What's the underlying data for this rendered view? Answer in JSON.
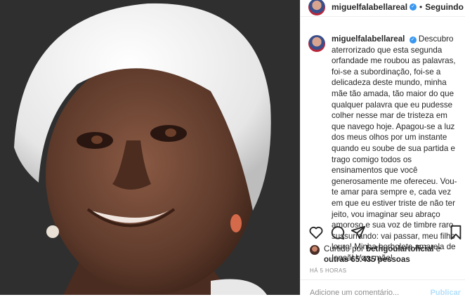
{
  "post": {
    "username": "miguelfalabellareal",
    "separator": "•",
    "follow_label": "Seguindo",
    "caption": "Descubro aterrorizado que esta segunda orfandade me roubou as palavras, foi-se a subordinação, foi-se a delicadeza deste mundo, minha mãe tão amada, tão maior do que qualquer palavra que eu pudesse colher nesse mar de tristeza em que navego hoje. Apagou-se a luz dos meus olhos por um instante quando eu soube de sua partida e trago comigo todos os ensinamentos que você generosamente me ofereceu. Vou-te amar para sempre e, cada vez em que eu estiver triste de não ter jeito, vou imaginar seu abraço amoroso e sua voz de timbre raro sussurrando: vai passar, meu filho louro! Minha borboleta amarela de Iansã! Voa, mãe!",
    "liked_prefix": "Curtido por",
    "liked_user": "bethgoulartoficial",
    "liked_and": "e",
    "liked_others": "outras 65.435 pessoas",
    "time_ago": "HÁ 5 HORAS",
    "comment_placeholder": "Adicione um comentário...",
    "publish_label": "Publicar"
  },
  "icons": {
    "verified": "verified-badge",
    "like": "heart-icon",
    "comment": "comment-icon",
    "share": "share-icon",
    "save": "bookmark-icon"
  },
  "colors": {
    "accent": "#3897f0",
    "muted": "#8e8e8e"
  }
}
